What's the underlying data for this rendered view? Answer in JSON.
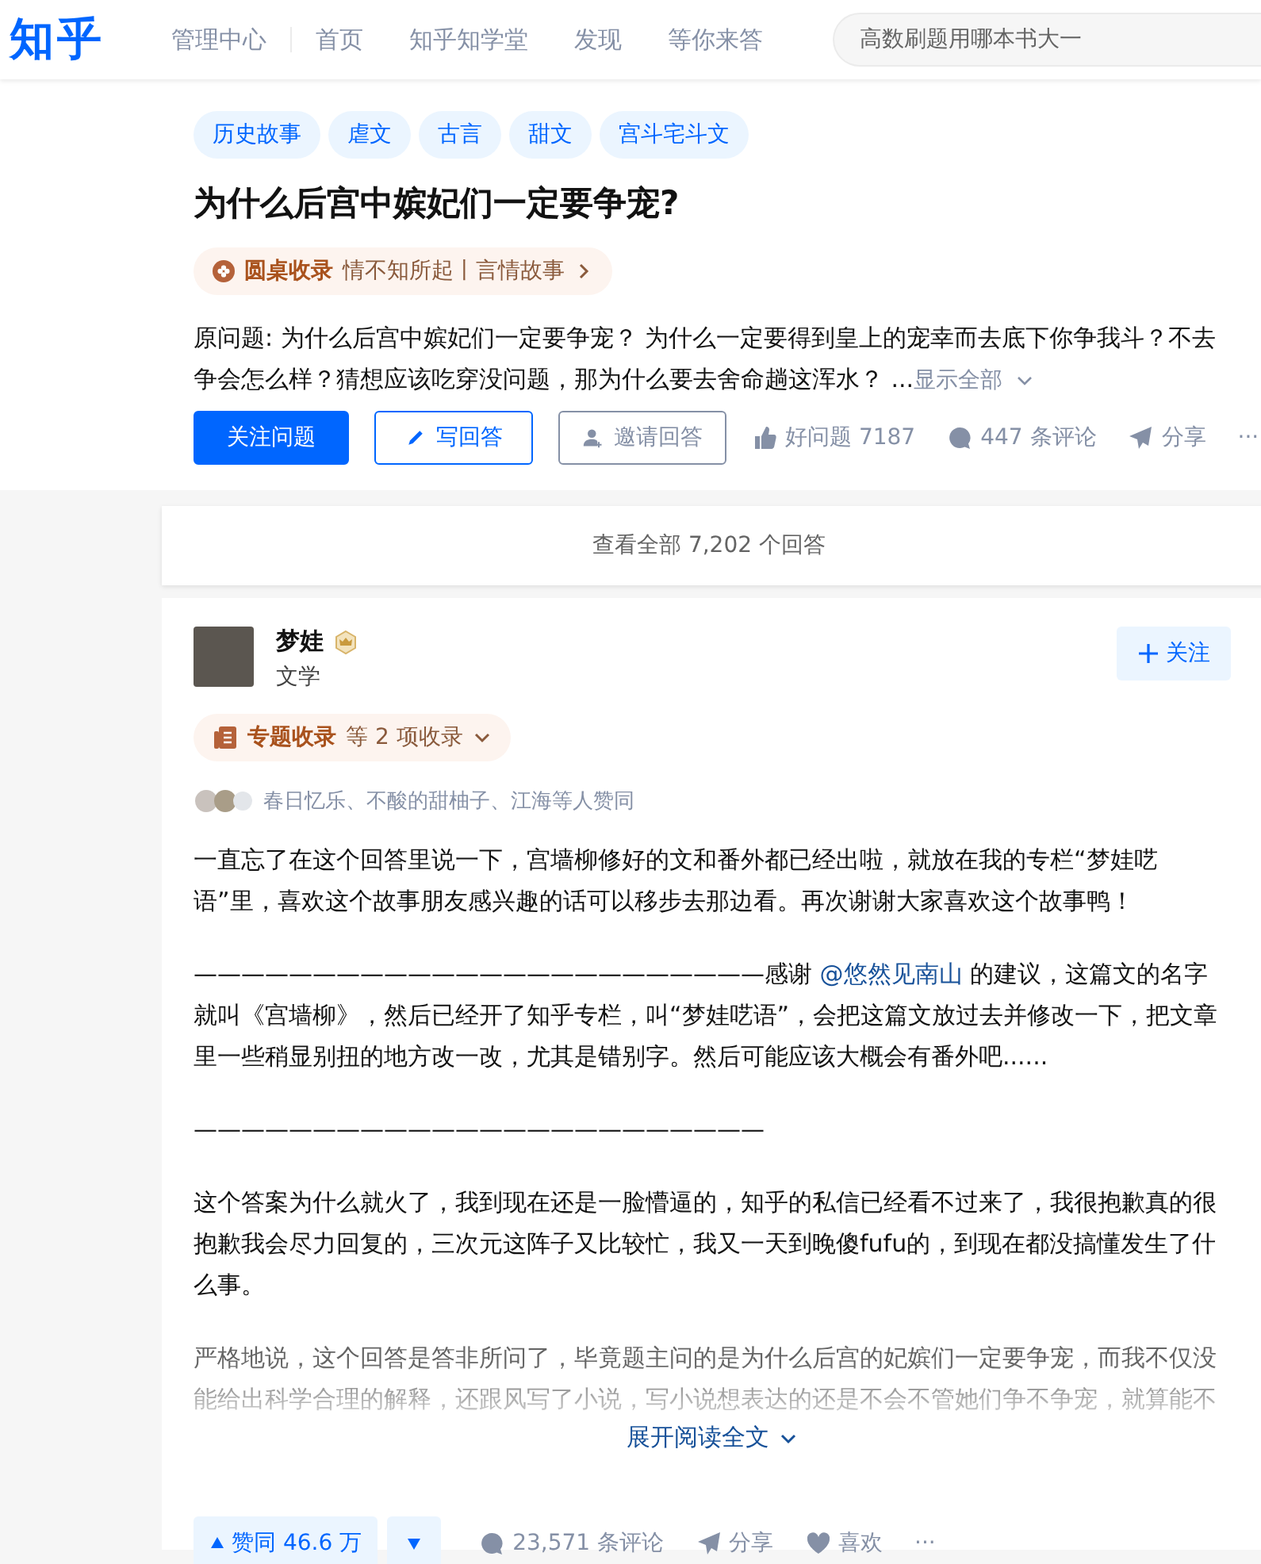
{
  "header": {
    "logo": "知乎",
    "nav": [
      "管理中心",
      "首页",
      "知乎知学堂",
      "发现",
      "等你来答"
    ],
    "search": {
      "placeholder": "高数刷题用哪本书大一"
    }
  },
  "question": {
    "tags": [
      "历史故事",
      "虐文",
      "古言",
      "甜文",
      "宫斗宅斗文"
    ],
    "title": "为什么后宫中嫔妃们一定要争宠?",
    "collection": {
      "label": "圆桌收录",
      "text": "情不知所起丨言情故事"
    },
    "detail": "原问题: 为什么后宫中嫔妃们一定要争宠？ 为什么一定要得到皇上的宠幸而去底下你争我斗？不去争会怎么样？猜想应该吃穿没问题，那为什么要去舍命趟这浑水？ ...",
    "show_all": "显示全部",
    "buttons": [
      {
        "kind": "primary",
        "label": "关注问题"
      },
      {
        "kind": "outline",
        "label": "写回答"
      },
      {
        "kind": "plain",
        "label": "邀请回答"
      }
    ],
    "actions": [
      {
        "kind": "like",
        "label": "好问题 7187"
      },
      {
        "kind": "comment",
        "label": "447 条评论"
      },
      {
        "kind": "share",
        "label": "分享"
      },
      {
        "kind": "more",
        "label": "···"
      }
    ]
  },
  "view_all": "查看全部 7,202 个回答",
  "answer": {
    "author": "梦娃",
    "bio": "文学",
    "follow": "关注",
    "collection": {
      "label": "专题收录",
      "text": "等 2 项收录"
    },
    "voters": "春日忆乐、不酸的甜柚子、江海等人赞同",
    "paragraphs": [
      {
        "kind": "text",
        "text": "一直忘了在这个回答里说一下，宫墙柳修好的文和番外都已经出啦，就放在我的专栏“梦娃呓语”里，喜欢这个故事朋友感兴趣的话可以移步去那边看。再次谢谢大家喜欢这个故事鸭！"
      },
      {
        "kind": "mention",
        "before": "————————————————————————感谢 ",
        "link": "@悠然见南山",
        "after": " 的建议，这篇文的名字就叫《宫墙柳》，然后已经开了知乎专栏，叫“梦娃呓语”，会把这篇文放过去并修改一下，把文章里一些稍显别扭的地方改一改，尤其是错别字。然后可能应该大概会有番外吧......"
      },
      {
        "kind": "rule",
        "text": "————————————————————————"
      },
      {
        "kind": "text",
        "text": "这个答案为什么就火了，我到现在还是一脸懵逼的，知乎的私信已经看不过来了，我很抱歉真的很抱歉我会尽力回复的，三次元这阵子又比较忙，我又一天到晚傻fufu的，到现在都没搞懂发生了什么事。"
      },
      {
        "kind": "faded",
        "text": "严格地说，这个回答是答非所问了，毕竟题主问的是为什么后宫的妃嫔们一定要争宠，而我不仅没能给出科学合理的解释，还跟风写了小说，写小说想表达的还是不会不管她们争不争宠，就算能不"
      }
    ],
    "expand": "展开阅读全文",
    "vote": "赞同 46.6 万",
    "actions": [
      {
        "kind": "comment",
        "label": "23,571 条评论"
      },
      {
        "kind": "share",
        "label": "分享"
      },
      {
        "kind": "heart",
        "label": "喜欢"
      },
      {
        "kind": "more",
        "label": "···"
      }
    ]
  }
}
